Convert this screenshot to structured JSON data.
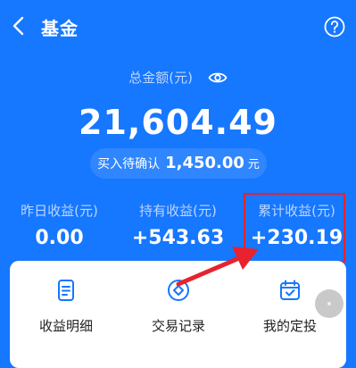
{
  "header": {
    "title": "基金",
    "back_icon": "chevron-left-icon",
    "help_icon": "question-circle-icon"
  },
  "summary": {
    "total_label": "总金额(元)",
    "total_amount": "21,604.49",
    "pending_label": "买入待确认",
    "pending_value": "1,450.00",
    "pending_unit": "元",
    "visibility_icon": "eye-icon"
  },
  "stats": [
    {
      "label": "昨日收益(元)",
      "value": "0.00"
    },
    {
      "label": "持有收益(元)",
      "value": "+543.63"
    },
    {
      "label": "累计收益(元)",
      "value": "+230.19"
    }
  ],
  "actions": [
    {
      "label": "收益明细",
      "icon": "document-icon"
    },
    {
      "label": "交易记录",
      "icon": "diamond-circle-icon"
    },
    {
      "label": "我的定投",
      "icon": "calendar-check-icon"
    }
  ],
  "colors": {
    "primary": "#1677ff",
    "annotation": "#e8222e"
  }
}
